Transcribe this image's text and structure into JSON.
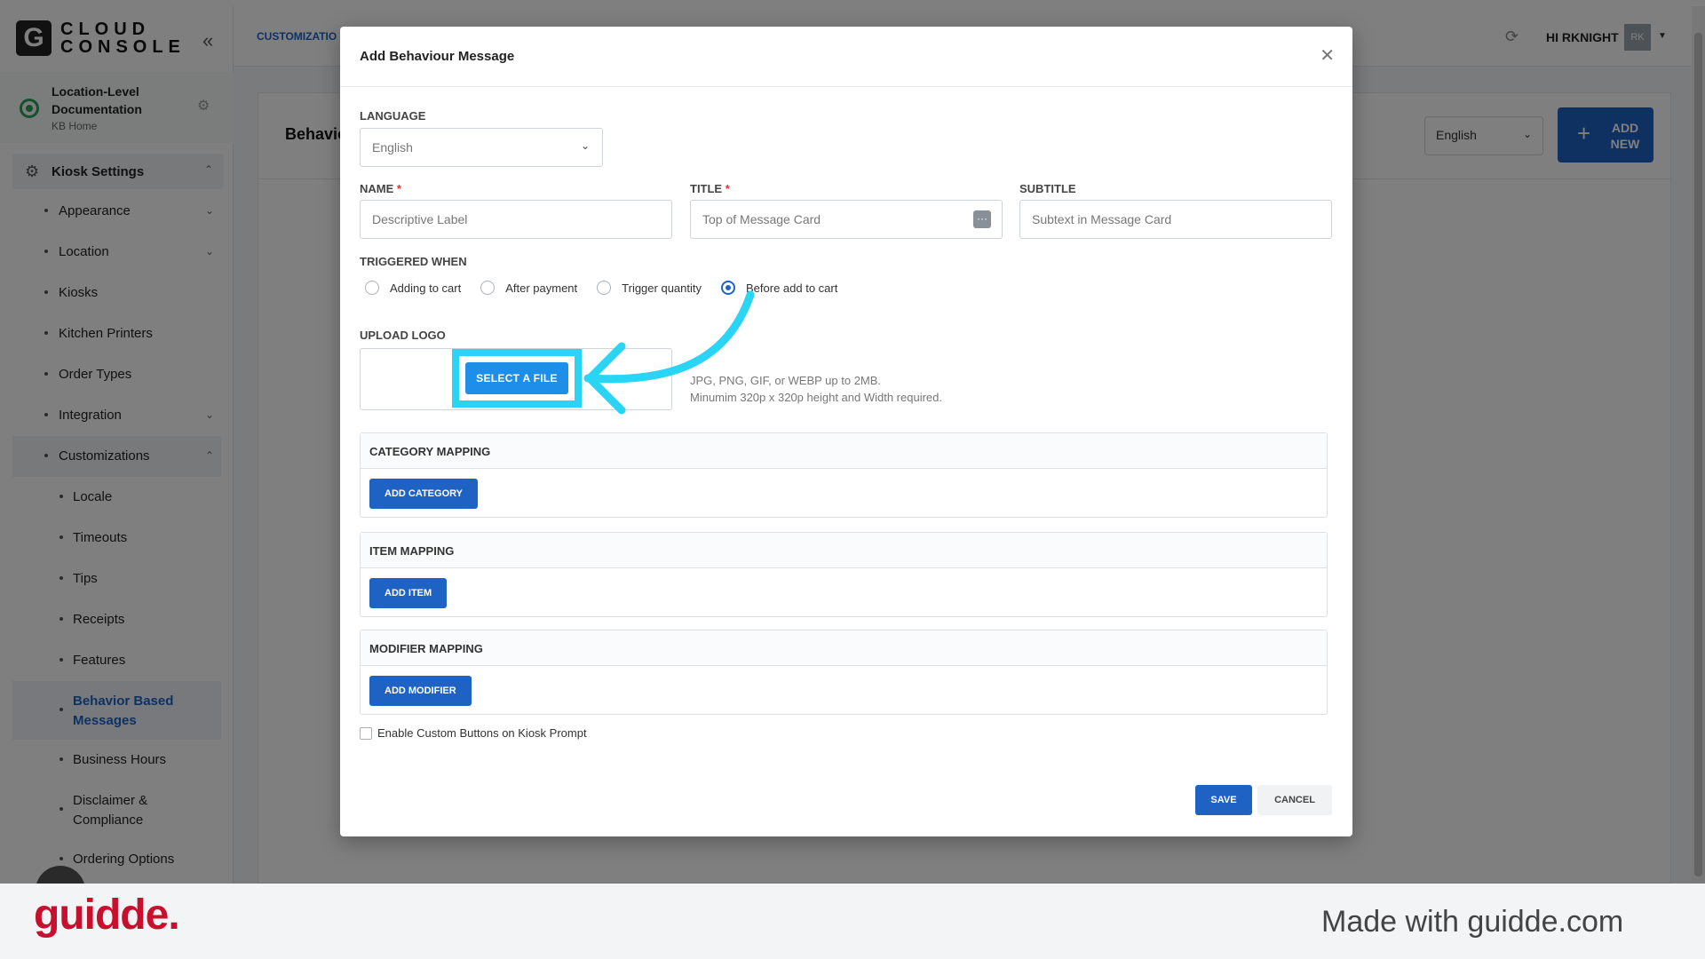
{
  "logo": {
    "letter": "G",
    "line1": "CLOUD",
    "line2": "CONSOLE"
  },
  "location": {
    "title": "Location-Level Documentation",
    "subtitle": "KB Home"
  },
  "sidebar": {
    "section_label": "Kiosk Settings",
    "items": [
      {
        "label": "Appearance"
      },
      {
        "label": "Location"
      },
      {
        "label": "Kiosks"
      },
      {
        "label": "Kitchen Printers"
      },
      {
        "label": "Order Types"
      },
      {
        "label": "Integration"
      },
      {
        "label": "Customizations"
      }
    ],
    "sub_items": [
      {
        "label": "Locale"
      },
      {
        "label": "Timeouts"
      },
      {
        "label": "Tips"
      },
      {
        "label": "Receipts"
      },
      {
        "label": "Features"
      },
      {
        "label": "Behavior Based Messages"
      },
      {
        "label": "Business Hours"
      },
      {
        "label": "Disclaimer & Compliance"
      },
      {
        "label": "Ordering Options"
      }
    ]
  },
  "header": {
    "breadcrumb": "CUSTOMIZATIO",
    "greeting": "HI RKNIGHT",
    "avatar_initials": "RK"
  },
  "content": {
    "title": "Behavio",
    "language_value": "English",
    "add_new_label": "ADD NEW"
  },
  "modal": {
    "title": "Add Behaviour Message",
    "language_label": "LANGUAGE",
    "language_value": "English",
    "name_label": "NAME",
    "name_placeholder": "Descriptive Label",
    "title_label": "TITLE",
    "title_placeholder": "Top of Message Card",
    "subtitle_label": "SUBTITLE",
    "subtitle_placeholder": "Subtext in Message Card",
    "required_mark": "*",
    "triggered_label": "TRIGGERED WHEN",
    "triggers": [
      "Adding to cart",
      "After payment",
      "Trigger quantity",
      "Before add to cart"
    ],
    "selected_trigger": "Before add to cart",
    "upload_label": "UPLOAD LOGO",
    "select_file_label": "SELECT A FILE",
    "upload_hint_1": "JPG, PNG, GIF, or WEBP up to 2MB.",
    "upload_hint_2": "Minumim 320p x 320p height and Width required.",
    "sections": [
      {
        "title": "CATEGORY MAPPING",
        "button": "ADD CATEGORY"
      },
      {
        "title": "ITEM MAPPING",
        "button": "ADD ITEM"
      },
      {
        "title": "MODIFIER MAPPING",
        "button": "ADD MODIFIER"
      }
    ],
    "custom_buttons_label": "Enable Custom Buttons on Kiosk Prompt",
    "save_label": "SAVE",
    "cancel_label": "CANCEL"
  },
  "footer": {
    "brand": "guidde.",
    "made_with": "Made with guidde.com"
  },
  "colors": {
    "primary": "#1e63c4",
    "highlight": "#2ad4f5",
    "brand_red": "#c8102e"
  }
}
